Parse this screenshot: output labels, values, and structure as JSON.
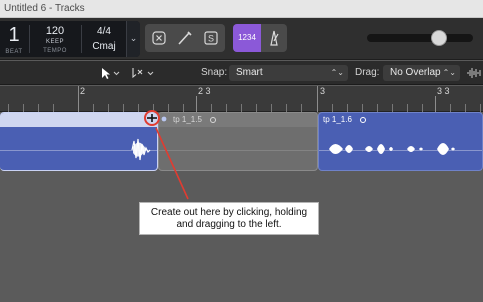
{
  "window": {
    "title": "Untitled 6 - Tracks"
  },
  "lcd": {
    "beat_value": "1",
    "beat_label": "BEAT",
    "tempo_value": "120",
    "tempo_mode": "KEEP",
    "tempo_label": "TEMPO",
    "signature": "4/4",
    "key": "Cmaj",
    "chevron": "⌄"
  },
  "control_buttons": {
    "count_in_label": "1234"
  },
  "toolbar": {
    "snap_label": "Snap:",
    "snap_value": "Smart",
    "drag_label": "Drag:",
    "drag_value": "No Overlap"
  },
  "ruler": {
    "labels": [
      "2",
      "2 3",
      "3",
      "3 3"
    ]
  },
  "regions": [
    {
      "name": ""
    },
    {
      "name": "tp 1_1.5"
    },
    {
      "name": "tp 1_1.6"
    }
  ],
  "callout": {
    "line1": "Create out here by clicking, holding",
    "line2": "and dragging to the left."
  },
  "colors": {
    "region_blue": "#4a5fb3",
    "region_header_light": "#cfd6f0",
    "region_empty_gray": "#6e6e6e",
    "annotation_red": "#e03c31",
    "count_in_purple": "#8b59d8"
  },
  "icons": {
    "ctl_1": "bypass-icon",
    "ctl_2": "pencil-icon",
    "ctl_3": "score-icon",
    "metronome": "metronome-icon",
    "pointer": "pointer-tool-icon",
    "secondary": "scissors-tool-icon"
  }
}
